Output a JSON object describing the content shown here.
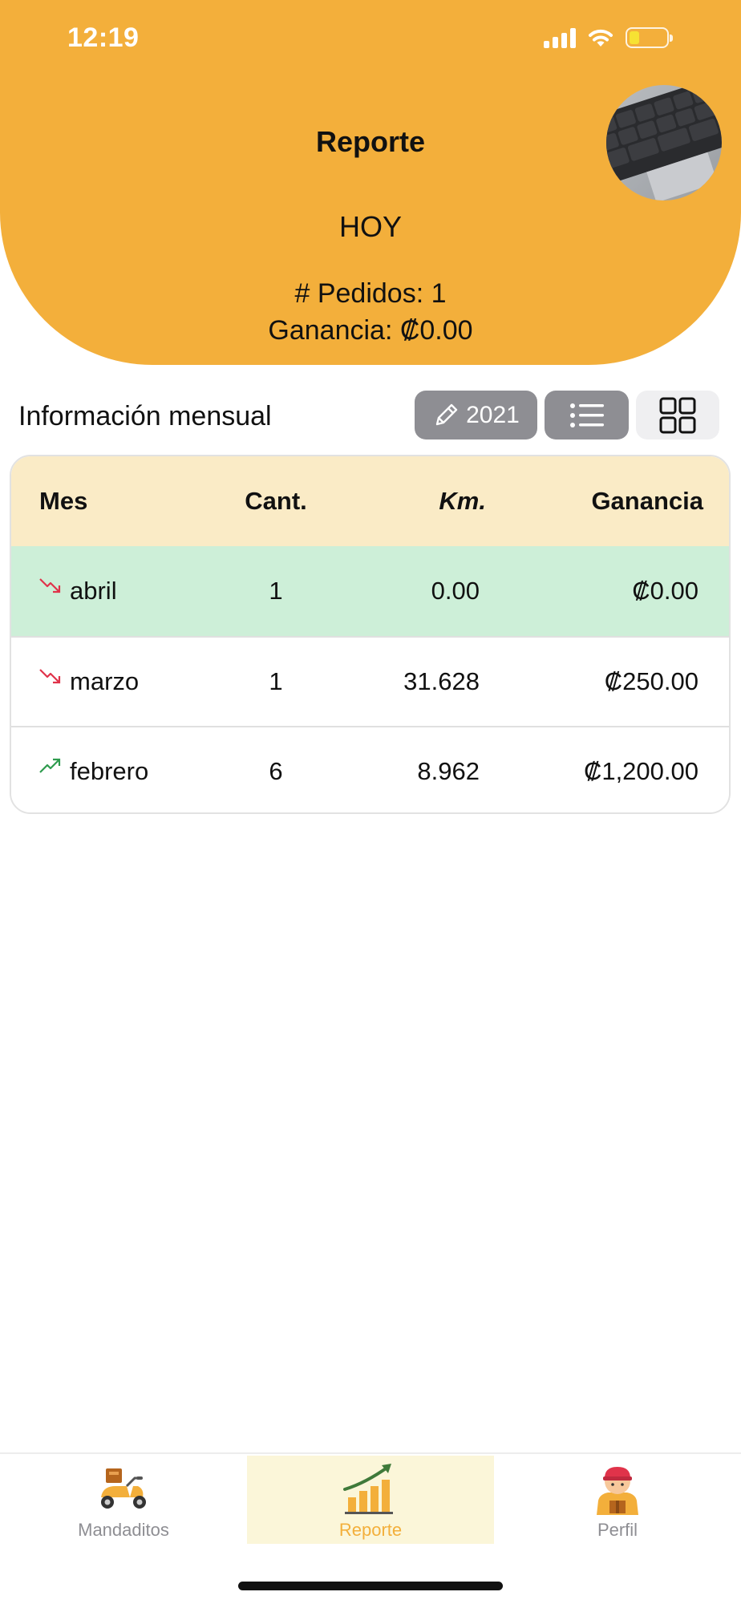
{
  "status_bar": {
    "time": "12:19"
  },
  "header": {
    "title": "Reporte",
    "today_label": "HOY",
    "orders_text": "# Pedidos: 1",
    "profit_text": "Ganancia: ₡0.00"
  },
  "section": {
    "title": "Información mensual",
    "year_button_label": "2021"
  },
  "table": {
    "headers": {
      "month": "Mes",
      "count": "Cant.",
      "km": "Km.",
      "profit": "Ganancia"
    },
    "rows": [
      {
        "month": "abril",
        "count": "1",
        "km": "0.00",
        "profit": "₡0.00",
        "trend": "down",
        "highlighted": true
      },
      {
        "month": "marzo",
        "count": "1",
        "km": "31.628",
        "profit": "₡250.00",
        "trend": "down",
        "highlighted": false
      },
      {
        "month": "febrero",
        "count": "6",
        "km": "8.962",
        "profit": "₡1,200.00",
        "trend": "up",
        "highlighted": false
      }
    ]
  },
  "tabbar": {
    "items": [
      {
        "label": "Mandaditos",
        "icon": "scooter-icon",
        "active": false
      },
      {
        "label": "Reporte",
        "icon": "growth-chart-icon",
        "active": true
      },
      {
        "label": "Perfil",
        "icon": "delivery-person-icon",
        "active": false
      }
    ]
  },
  "colors": {
    "header_bg": "#F3AF3B",
    "table_header_bg": "#FAEBC6",
    "highlight_row_bg": "#CDEFD8",
    "trend_down": "#E0334A",
    "trend_up": "#2E9B4E",
    "active_tab_bg": "#FBF6D9"
  }
}
